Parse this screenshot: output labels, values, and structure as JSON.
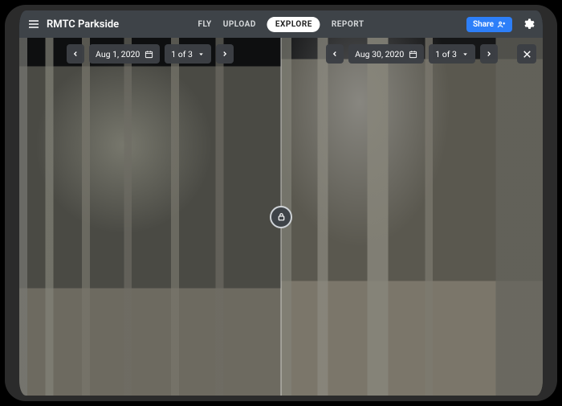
{
  "project": {
    "title": "RMTC Parkside"
  },
  "nav": {
    "tabs": [
      {
        "label": "FLY",
        "active": false
      },
      {
        "label": "UPLOAD",
        "active": false
      },
      {
        "label": "EXPLORE",
        "active": true
      },
      {
        "label": "REPORT",
        "active": false
      }
    ],
    "share_label": "Share"
  },
  "compare": {
    "left": {
      "date": "Aug 1, 2020",
      "page_label": "1 of 3"
    },
    "right": {
      "date": "Aug 30, 2020",
      "page_label": "1 of 3"
    }
  },
  "icons": {
    "menu": "menu-icon",
    "gear": "gear-icon",
    "calendar": "calendar-icon",
    "chevron_left": "chevron-left-icon",
    "chevron_right": "chevron-right-icon",
    "chevron_down": "chevron-down-icon",
    "close": "close-icon",
    "lock": "lock-icon",
    "share": "share-icon"
  },
  "colors": {
    "accent": "#2d7ff9",
    "topbar": "#3e4348",
    "pill_bg": "#ffffff"
  }
}
